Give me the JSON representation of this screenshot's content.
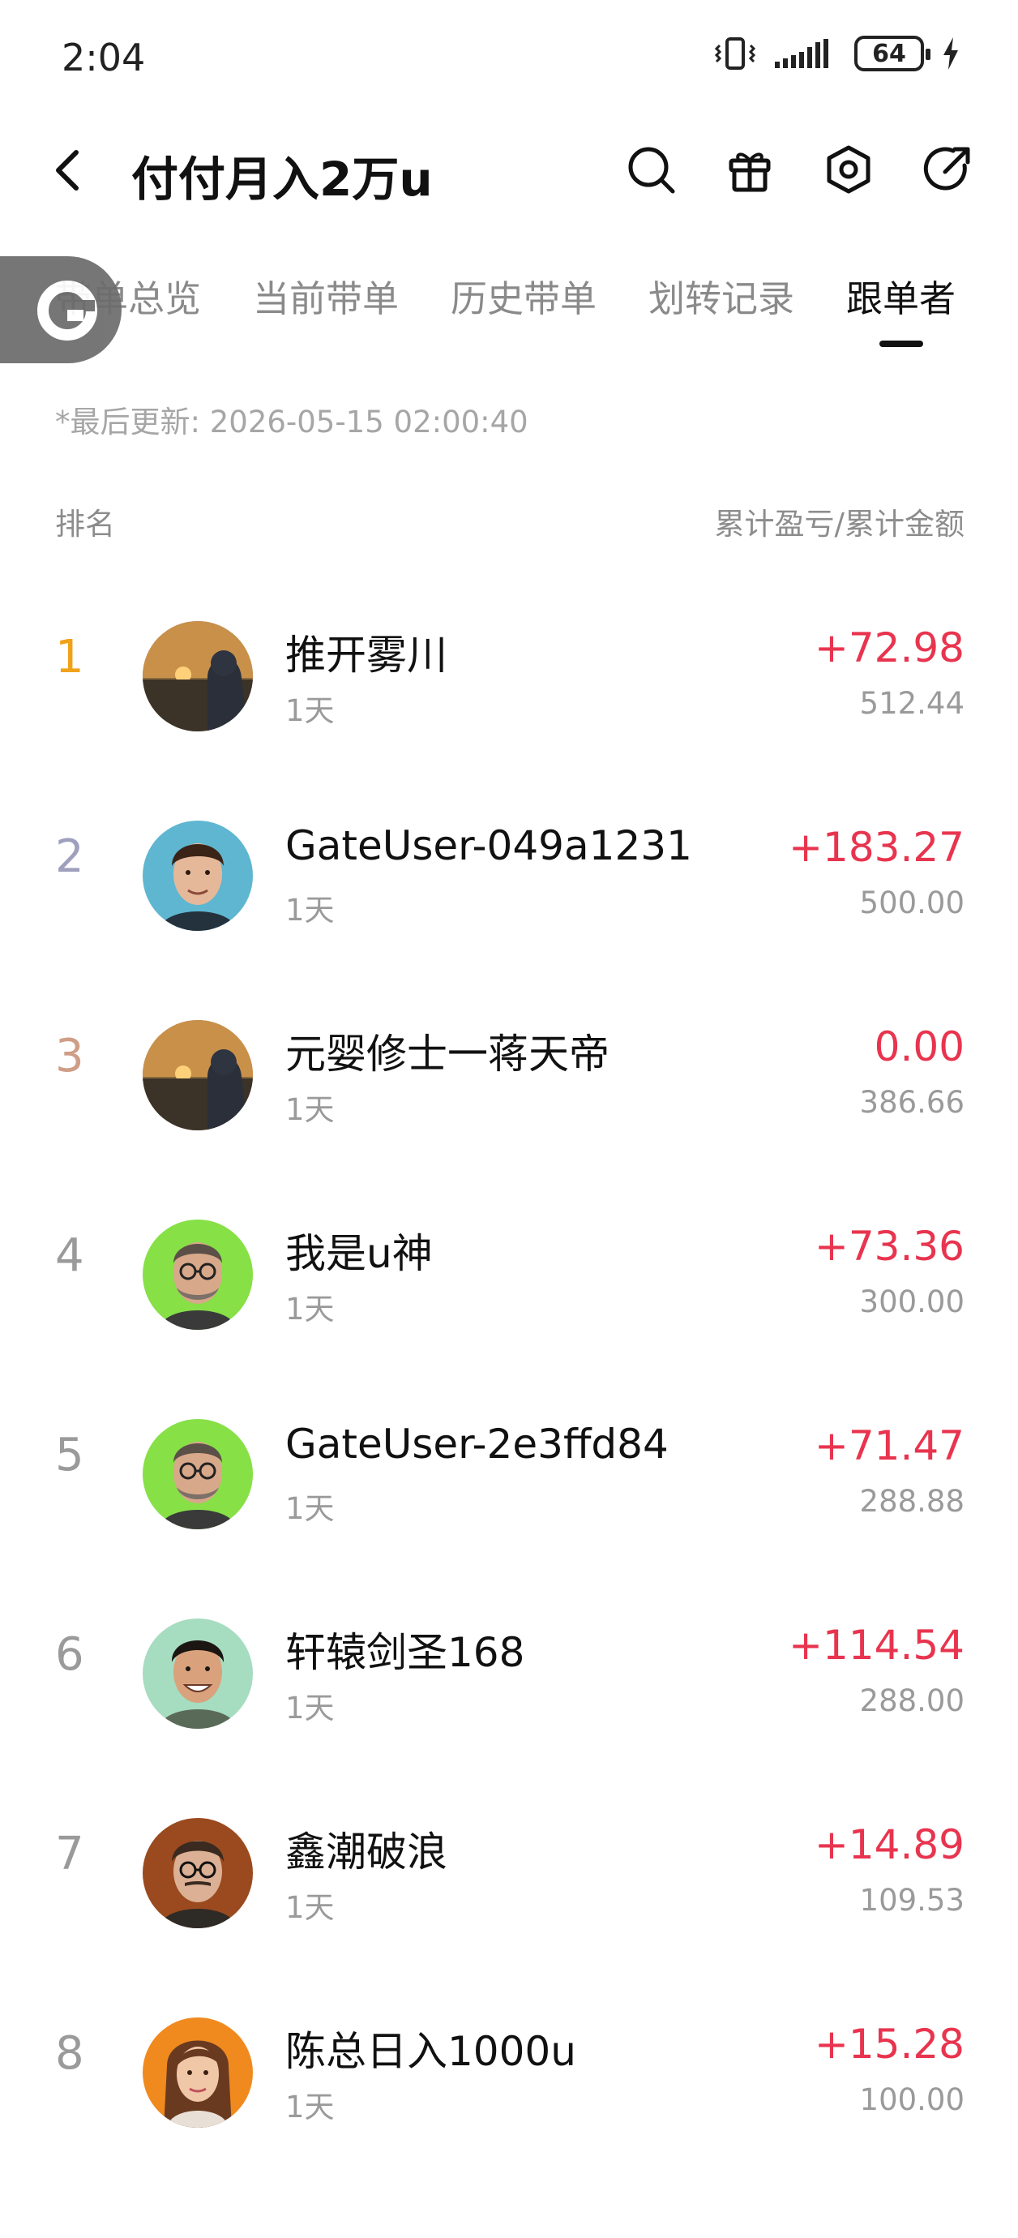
{
  "status_bar": {
    "time": "2:04",
    "battery": "64"
  },
  "header": {
    "title": "付付月入2万u",
    "icons": [
      "back-arrow-icon",
      "search-icon",
      "gift-icon",
      "hexagon-settings-icon",
      "share-icon"
    ]
  },
  "tabs": [
    {
      "label": "带单总览",
      "active": false
    },
    {
      "label": "当前带单",
      "active": false
    },
    {
      "label": "历史带单",
      "active": false
    },
    {
      "label": "划转记录",
      "active": false
    },
    {
      "label": "跟单者",
      "active": true
    }
  ],
  "update": {
    "label": "*最后更新:",
    "time": "2026-05-15 02:00:40"
  },
  "columns": {
    "rank": "排名",
    "pnl": "累计盈亏/累计金额"
  },
  "followers": [
    {
      "rank": "1",
      "name": "推开雾川",
      "days": "1天",
      "pnl": "+72.98",
      "amount": "512.44",
      "avatar": "sunset-landscape"
    },
    {
      "rank": "2",
      "name": "GateUser-049a1231",
      "days": "1天",
      "pnl": "+183.27",
      "amount": "500.00",
      "avatar": "young-man-blue"
    },
    {
      "rank": "3",
      "name": "元婴修士一蒋天帝",
      "days": "1天",
      "pnl": "0.00",
      "amount": "386.66",
      "avatar": "sunset-landscape"
    },
    {
      "rank": "4",
      "name": "我是u神",
      "days": "1天",
      "pnl": "+73.36",
      "amount": "300.00",
      "avatar": "man-glasses-green"
    },
    {
      "rank": "5",
      "name": "GateUser-2e3ffd84",
      "days": "1天",
      "pnl": "+71.47",
      "amount": "288.88",
      "avatar": "man-glasses-green"
    },
    {
      "rank": "6",
      "name": "轩辕剑圣168",
      "days": "1天",
      "pnl": "+114.54",
      "amount": "288.00",
      "avatar": "smiling-man-mint"
    },
    {
      "rank": "7",
      "name": "鑫潮破浪",
      "days": "1天",
      "pnl": "+14.89",
      "amount": "109.53",
      "avatar": "man-glasses-brown"
    },
    {
      "rank": "8",
      "name": "陈总日入1000u",
      "days": "1天",
      "pnl": "+15.28",
      "amount": "100.00",
      "avatar": "woman-orange"
    }
  ],
  "colors": {
    "profit": "#e8344e",
    "rank_gold": "#f0a21a",
    "rank_silver": "#9fa0bd",
    "rank_bronze": "#cf9e87",
    "muted": "#9a9a9a"
  }
}
